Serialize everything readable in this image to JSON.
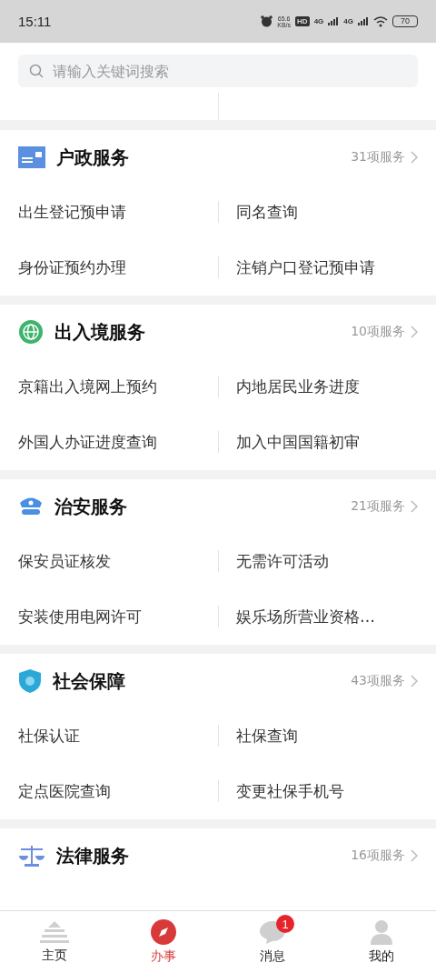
{
  "status_bar": {
    "time": "15:11",
    "speed": "65.6",
    "speed_unit": "KB/s",
    "hd": "HD",
    "networks": [
      "4G",
      "4G"
    ],
    "battery": "70"
  },
  "search": {
    "placeholder": "请输入关键词搜索"
  },
  "sections": [
    {
      "kind": "household",
      "title": "户政服务",
      "count": "31项服务",
      "items": [
        "出生登记预申请",
        "同名查询",
        "身份证预约办理",
        "注销户口登记预申请"
      ]
    },
    {
      "kind": "globe",
      "title": "出入境服务",
      "count": "10项服务",
      "items": [
        "京籍出入境网上预约",
        "内地居民业务进度",
        "外国人办证进度查询",
        "加入中国国籍初审"
      ]
    },
    {
      "kind": "police",
      "title": "治安服务",
      "count": "21项服务",
      "items": [
        "保安员证核发",
        "无需许可活动",
        "安装使用电网许可",
        "娱乐场所营业资格…"
      ]
    },
    {
      "kind": "social",
      "title": "社会保障",
      "count": "43项服务",
      "items": [
        "社保认证",
        "社保查询",
        "定点医院查询",
        "变更社保手机号"
      ]
    },
    {
      "kind": "law",
      "title": "法律服务",
      "count": "16项服务"
    }
  ],
  "tabs": [
    {
      "kind": "home",
      "label": "主页",
      "selected": false
    },
    {
      "kind": "compass",
      "label": "办事",
      "selected": true
    },
    {
      "kind": "chat",
      "label": "消息",
      "selected": false,
      "badge": "1"
    },
    {
      "kind": "person",
      "label": "我的",
      "selected": false
    }
  ]
}
